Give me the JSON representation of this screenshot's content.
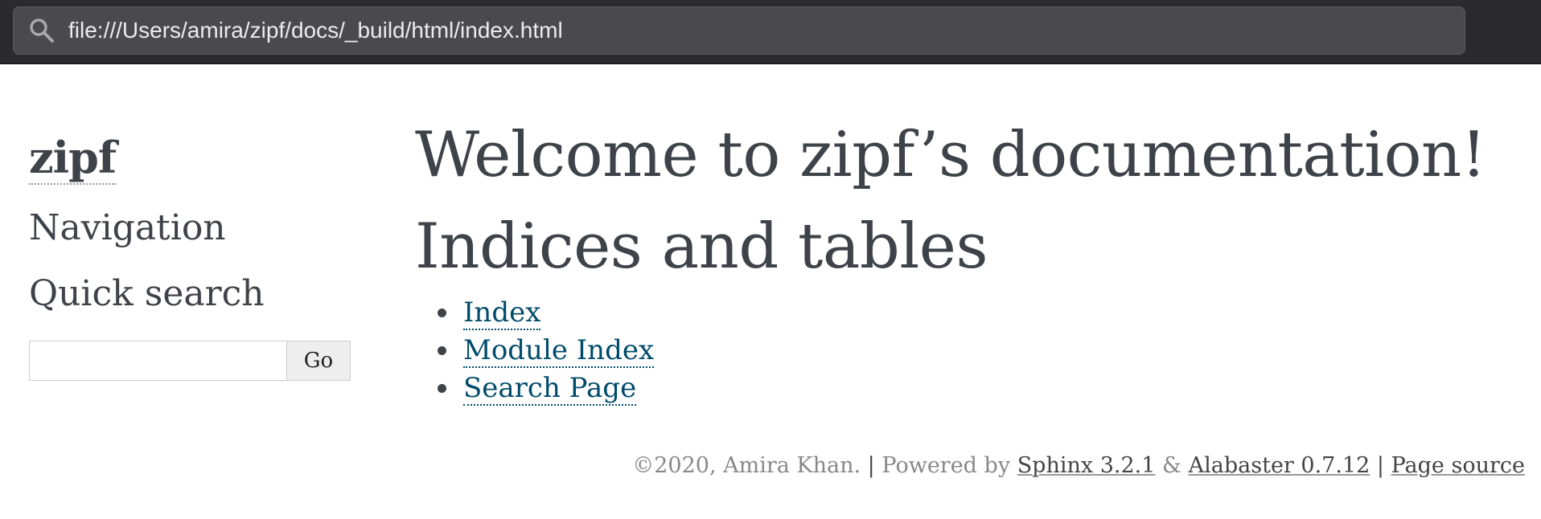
{
  "browser": {
    "url": "file:///Users/amira/zipf/docs/_build/html/index.html"
  },
  "sidebar": {
    "project_name": "zipf",
    "navigation_heading": "Navigation",
    "search_heading": "Quick search",
    "search_value": "",
    "go_label": "Go"
  },
  "main": {
    "title": "Welcome to zipf’s documentation!",
    "indices_heading": "Indices and tables",
    "links": [
      {
        "label": "Index"
      },
      {
        "label": "Module Index"
      },
      {
        "label": "Search Page"
      }
    ]
  },
  "footer": {
    "copyright": "©2020, Amira Khan.",
    "separator": "|",
    "powered_by": "Powered by",
    "sphinx_link": "Sphinx 3.2.1",
    "ampersand": "&",
    "alabaster_link": "Alabaster 0.7.12",
    "page_source_link": "Page source"
  },
  "colors": {
    "text": "#3e4349",
    "link": "#004b6b",
    "chrome_bg": "#2b2b2d",
    "address_bg": "#4a4a4c"
  }
}
